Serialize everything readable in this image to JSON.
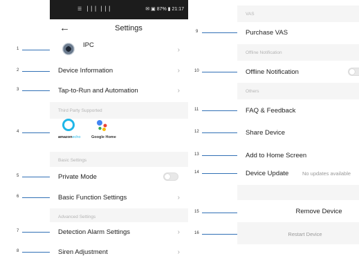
{
  "status_bar": {
    "signal": "☰ ▕▕▕ ▕▕▕",
    "right": "✉ ▣ 87% ▮ 21:17"
  },
  "header": {
    "back": "←",
    "title": "Settings"
  },
  "device": {
    "name": "IPC"
  },
  "items": {
    "device_information": "Device Information",
    "tap_to_run": "Tap-to-Run and Automation",
    "private_mode": "Private Mode",
    "basic_function": "Basic Function Settings",
    "detection_alarm": "Detection Alarm Settings",
    "siren": "Siren Adjustment",
    "purchase_vas": "Purchase VAS",
    "offline_notification": "Offline Notification",
    "faq": "FAQ & Feedback",
    "share_device": "Share Device",
    "add_home": "Add to Home Screen",
    "device_update": "Device Update",
    "device_update_status": "No updates available",
    "remove_device": "Remove Device",
    "restart_device": "Restart Device"
  },
  "sections": {
    "third_party": "Third Party Supported",
    "basic": "Basic Settings",
    "advanced": "Advanced Settings",
    "vas": "VAS",
    "offline": "Offline Notification",
    "others": "Others"
  },
  "third_party": {
    "echo_brand": "amazon",
    "echo_product": "echo",
    "google_home": "Google Home"
  },
  "chevron": "›",
  "callouts": [
    "1",
    "2",
    "3",
    "4",
    "5",
    "6",
    "7",
    "8",
    "9",
    "10",
    "11",
    "12",
    "13",
    "14",
    "15",
    "16"
  ],
  "colors": {
    "callout": "#2f6fb5",
    "echo": "#1fb6e8",
    "section_bg": "#f5f5f5"
  }
}
